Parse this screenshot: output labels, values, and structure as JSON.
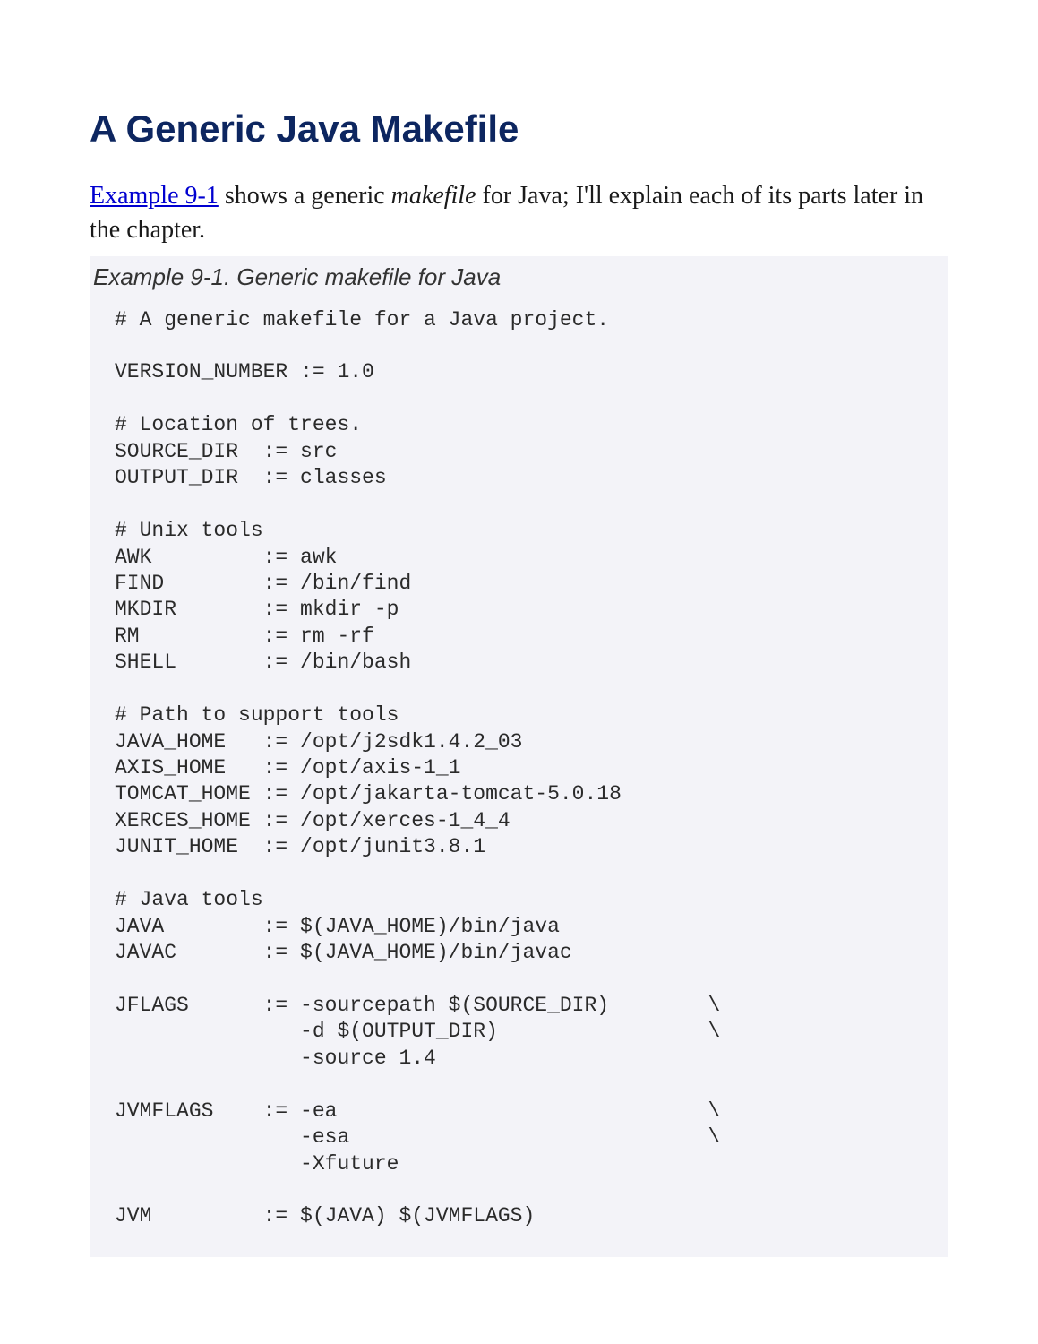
{
  "heading": "A Generic Java Makefile",
  "intro": {
    "link_text": "Example 9-1",
    "text_before_italic": " shows a generic ",
    "italic_word": "makefile",
    "text_after_italic": " for Java; I'll explain each of its parts later in the chapter."
  },
  "example": {
    "caption": "Example 9-1. Generic makefile for Java",
    "code": "# A generic makefile for a Java project.\n\nVERSION_NUMBER := 1.0\n\n# Location of trees.\nSOURCE_DIR  := src\nOUTPUT_DIR  := classes\n\n# Unix tools\nAWK         := awk\nFIND        := /bin/find\nMKDIR       := mkdir -p\nRM          := rm -rf\nSHELL       := /bin/bash\n\n# Path to support tools\nJAVA_HOME   := /opt/j2sdk1.4.2_03\nAXIS_HOME   := /opt/axis-1_1\nTOMCAT_HOME := /opt/jakarta-tomcat-5.0.18\nXERCES_HOME := /opt/xerces-1_4_4\nJUNIT_HOME  := /opt/junit3.8.1\n\n# Java tools\nJAVA        := $(JAVA_HOME)/bin/java\nJAVAC       := $(JAVA_HOME)/bin/javac\n\nJFLAGS      := -sourcepath $(SOURCE_DIR)        \\\n               -d $(OUTPUT_DIR)                 \\\n               -source 1.4\n\nJVMFLAGS    := -ea                              \\\n               -esa                             \\\n               -Xfuture\n\nJVM         := $(JAVA) $(JVMFLAGS)"
  }
}
